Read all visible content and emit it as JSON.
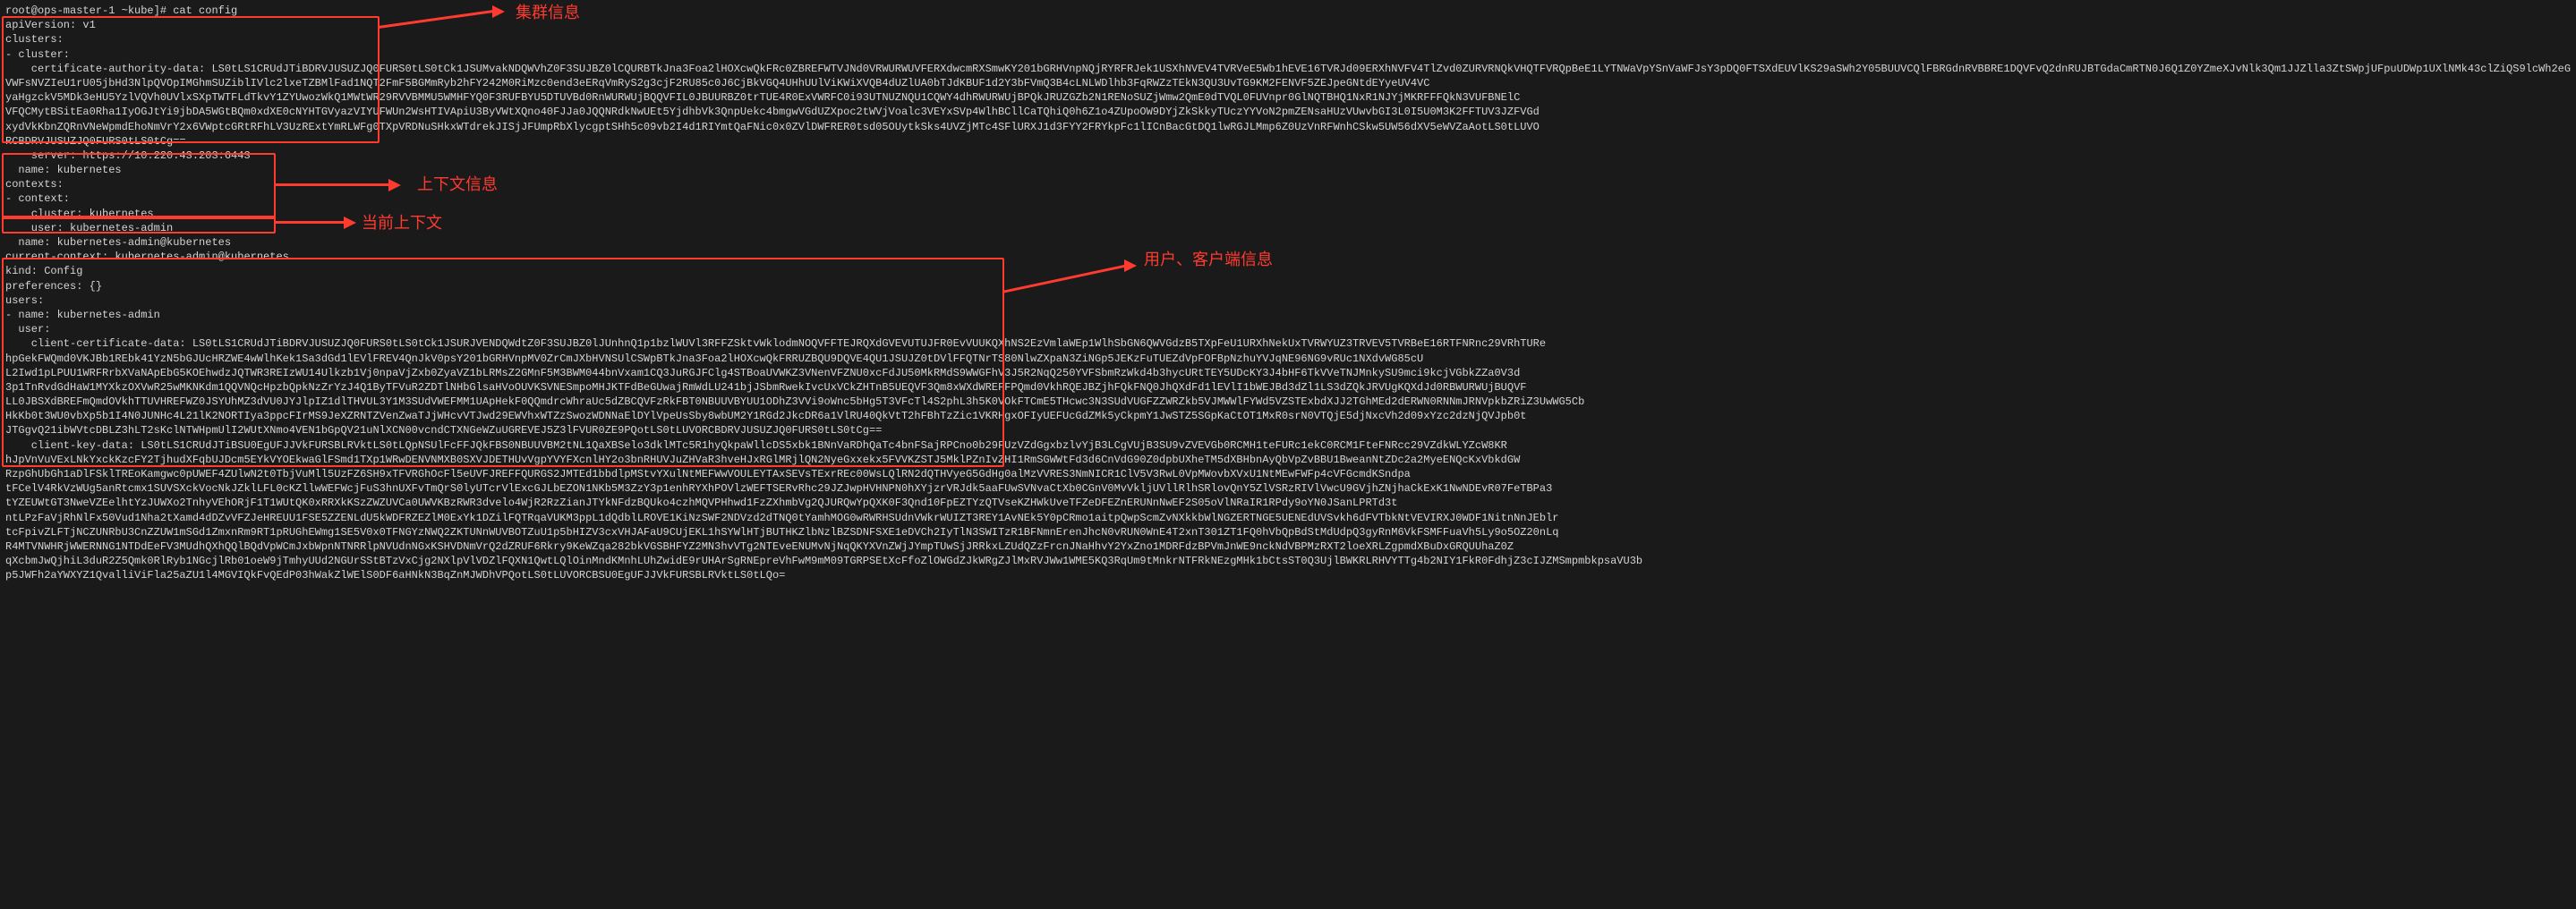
{
  "prompt": "root@ops-master-1 ~kube]# cat config",
  "config_lines": [
    "apiVersion: v1",
    "clusters:",
    "- cluster:",
    "    certificate-authority-data: LS0tLS1CRUdJTiBDRVJUSUZJQ0FURS0tLS0tCk1JSUMvakNDQWVhZ0F3SUJBZ0lCQURBTkJna3Foa2lHOXcwQkFRc0ZBREFWTVJNd0VRWURWUVFERXdwcmRXSmwKY201bGRHVnpNQjRYRFRJek1USXhNVEV4TVRVeE5Wb1hEVE16TVRJd09ERXhNVFV4TlZvd0ZURVRNQkVHQTFVRQpBeE1LYTNWaVpYSnVaWFJsY3pDQ0FTSXdEUVlKS29aSWh2Y05BUUVCQlFBRGdnRVBBRE1DQVFvQ2dnRUJBTGdaCmRTN0J6Q1Z0YZmeXJvNlk3Qm1JJZlla3ZtSWpjUFpuUDWp1UXlNMk43clZiQS9lcWh2eGQ2cmZtczM3B5L1ZyL2F5TEYyMG0waDdsQnRTMlRiUXVHRkRzUTQw",
    "VWFsNVZIeU1rU05jbHd3NlpQVOpIMGhmSUZiblIVlc2lxeTZBMlFad1NQT2FmF5BGMmRyb2hFY242M0RiMzc0end3eERqVmRyS2g3cjF2RU85c0J6CjBkVGQ4UHhUUlViKWiXVQB4dUZlUA0bTJdKBUF1d2Y3bFVmQ3B4cLNLWDlhb3FqRWZzTEkN3QU3UvTG9KM2FENVF5ZEJpeGNtdEYyeUV4VC",
    "yaHgzckV5MDk3eHU5YzlVQVh0UVlxSXpTWTFLdTkvY1ZYUwozWkQ1MWtWR29RVVBMMU5WMHFYQ0F3RUFBYU5DTUVBd0RnWURWUjBQQVFIL0JBUURBZ0trTUE4R0ExVWRFC0i93UTNUZNQU1CQWY4dhRWURWUjBPQkJRUZGZb2N1RENoSUZjWmw2QmE0dTVQL0FUVnpr0GlNQTBHQ1NxR1NJYjMKRFFFQkN3VUFBNElC",
    "VFQCMytBSitEa0Rha1IyOGJtYi9jbDA5WGtBQm0xdXE0cNYHTGVyazVIYUFWUn2WsHTIVApiU3ByVWtXQno40FJJa0JQQNRdkNwUEt5YjdhbVk3QnpUekc4bmgwVGdUZXpoc2tWVjVoalc3VEYxSVp4WlhBCllCaTQhiQ0h6Z1o4ZUpoOW9DYjZkSkkyTUczYYVoN2pmZENsaHUzVUwvbGI3L0I5U0M3K2FFTUV3JZFVGd",
    "xydVkKbnZQRnVNeWpmdEhoNmVrY2x6VWptcGRtRFhLV3UzRExtYmRLWFg0TXpVRDNuSHkxWTdrekJISjJFUmpRbXlycgptSHh5c09vb2I4d1RIYmtQaFNic0x0ZVlDWFRER0tsd05OUytkSks4UVZjMTc4SFlURXJ1d3FYY2FRYkpFc1lICnBacGtDQ1lwRGJLMmp6Z0UzVnRFWnhCSkw5UW56dXV5eWVZaAotLS0tLUVO",
    "RCBDRVJUSUZJQ0FURS0tLS0tCg==",
    "    server: https://10.220.43.203:6443",
    "  name: kubernetes",
    "contexts:",
    "- context:",
    "    cluster: kubernetes",
    "    user: kubernetes-admin",
    "  name: kubernetes-admin@kubernetes",
    "current-context: kubernetes-admin@kubernetes",
    "kind: Config",
    "preferences: {}",
    "users:",
    "- name: kubernetes-admin",
    "  user:",
    "    client-certificate-data: LS0tLS1CRUdJTiBDRVJUSUZJQ0FURS0tLS0tCk1JSURJVENDQWdtZ0F3SUJBZ0lJUnhnQ1p1bzlWUVl3RFFZSktvWklodmNOQVFFTEJRQXdGVEVUTUJFR0EvVUUKQXhNS2EzVmlaWEp1WlhSbGN6QWVGdzB5TXpFeU1URXhNekUxTVRWYUZ3TRVEV5TVRBeE16RTFNRnc29VRhTURe",
    "hpGekFWQmd0VKJBb1REbk41YzN5bGJUcHRZWE4wWlhKek1Sa3dGd1lEVlFREV4QnJkV0psY201bGRHVnpMV0ZrCmJXbHVNSUlCSWpBTkJna3Foa2lHOXcwQkFRRUZBQU9DQVE4QU1JSUJZ0tDVlFFQTNrTS80NlwZXpaN3ZiNGp5JEKzFuTUEZdVpFOFBpNzhuYVJqNE96NG9vRUc1NXdvWG85cU",
    "L2Iwd1pLPUU1WRFRrbXVaNApEbG5KOEhwdzJQTWR3REIzWU14Ulkzb1Vj0npaVjZxb0ZyaVZ1bLRMsZ2GMnF5M3BWM044bnVxam1CQ3JuRGJFClg4STBoaUVWKZ3VNenVFZNU0xcFdJU50MkRMdS9WWGFhV3J5R2NqQ250YVFSbmRzWkd4b3hycURtTEY5UDcKY3J4bHF6TkVVeTNJMnkySU9mci9kcjVGbkZZa0V3d",
    "3p1TnRvdGdHaW1MYXkzOXVwR25wMKNKdm1QQVNQcHpzbQpkNzZrYzJ4Q1ByTFVuR2ZDTlNHbGlsaHVoOUVKSVNESmpoMHJKTFdBeGUwajRmWdLU241bjJSbmRwekIvcUxVCkZHTnB5UEQVF3Qm8xWXdWREFFPQmd0VkhRQEJBZjhFQkFNQ0JhQXdFd1lEVlI1bWEJBd3dZl1LS3dZQkJRVUgKQXdJd0RBWURWUjBUQVF",
    "LL0JBSXdBREFmQmdOVkhTTUVHREFWZ0JSYUhMZ3dVU0JYJlpIZ1dlTHVUL3Y1M3SUdVWEFMM1UApHekF0QQmdrcWhraUc5dZBCQVFzRkFBT0NBUUVBYUU1ODhZ3VVi9oWnc5bHg5T3VFcTl4S2phL3h5K0VOkFTCmE5THcwc3N3SUdVUGFZZWRZkb5VJMWWlFYWd5VZSTExbdXJJ2TGhMEd2dERWN0RNNmJRNVpkbZRiZ3UwWG5Cb",
    "HkKb0t3WU0vbXp5b1I4N0JUNHc4L21lK2NORTIya3ppcFIrMS9JeXZRNTZVenZwaTJjWHcvVTJwd29EWVhxWTZzSwozWDNNaElDYlVpeUsSby8wbUM2Y1RGd2JkcDR6a1VlRU40QkVtT2hFBhTzZic1VKRHgxOFIyUEFUcGdZMk5yCkpmY1JwSTZ5SGpKaCtOT1MxR0srN0VTQjE5djNxcVh2d09xYzc2dzNjQVJpb0t",
    "JTGgvQ21ibWVtcDBLZ3hLT2sKclNTWHpmUlI2WUtXNmo4VEN1bGpQV21uNlXCN00vcndCTXNGeWZuUGREVEJ5Z3lFVUR0ZE9PQotLS0tLUVORCBDRVJUSUZJQ0FURS0tLS0tCg==",
    "    client-key-data: LS0tLS1CRUdJTiBSU0EgUFJJVkFURSBLRVktLS0tLQpNSUlFcFFJQkFBS0NBUUVBM2tNL1QaXBSelo3dklMTc5R1hyQkpaWllcDS5xbk1BNnVaRDhQaTc4bnFSajRPCno0b29FUzVZdGgxbzlvYjB3LCgVUjB3SU9vZVEVGb0RCMH1teFURc1ekC0RCM1FteFNRcc29VZdkWLYZcW8KR",
    "hJpVnVuVExLNkYxckKzcFY2TjhudXFqbUJDcm5EYkVYOEkwaGlFSmd1TXp1WRwDENVNMXB0SXVJDETHUvVgpYVYFXcnlHY2o3bnRHUVJuZHVaR3hveHJxRGlMRjlQN2NyeGxxekx5FVVKZSTJ5MklPZnIvZHI1RmSGWWtFd3d6CnVdG90Z0dpbUXheTM5dXBHbnAyQbVpZvBBU1BweanNtZDc2a2MyeENQcKxVbkdGW",
    "RzpGhUbGh1aDlFSklTREoKamgwc0pUWEF4ZUlwN2t0TbjVuMll5UzFZ6SH9xTFVRGhOcFl5eUVFJREFFQURGS2JMTEd1bbdlpMStvYXulNtMEFWwVOULEYTAxSEVsTExrREc00WsLQlRN2dQTHVyeG5GdHg0alMzVVRES3NmNICR1ClV5V3RwL0VpMWovbXVxU1NtMEwFWFp4cVFGcmdKSndpa",
    "tFCelV4RkVzWUg5anRtcmx1SUVSXckVocNkJZklLFL0cKZllwWEFWcjFuS3hnUXFvTmQrS0lyUTcrVlExcGJLbEZON1NKb5M3ZzY3p1enhRYXhPOVlzWEFTSERvRhc29JZJwpHVHNPN0hXYjzrVRJdk5aaFUwSVNvaCtXb0CGnV0MvVkljUVllRlhSRlovQnY5ZlVSRzRIVlVwcU9GVjhZNjhaCkExK1NwNDEvR07FeTBPa3",
    "tYZEUWtGT3NweVZEelhtYzJUWXo2TnhyVEhORjF1T1WUtQK0xRRXkKSzZWZUVCa0UWVKBzRWR3dvelo4WjR2RzZianJTYkNFdzBQUko4czhMQVPHhwd1FzZXhmbVg2QJURQwYpQXK0F3Qnd10FpEZTYzQTVseKZHWkUveTFZeDFEZnERUNnNwEF2S05oVlNRaIR1RPdy9oYN0JSanLPRTd3t",
    "ntLPzFaVjRhNlFx50Vud1Nha2tXamd4dDZvVFZJeHREUU1FSE5ZZENLdU5kWDFRZEZlM0ExYk1DZilFQTRqaVUKM3ppL1dQdblLROVE1KiNzSWF2NDVzd2dTNQ0tYamhMOG0wRWRHSUdnVWkrWUIZT3REY1AvNEk5Y0pCRmo1aitpQwpScmZvNXkkbWlNGZERTNGE5UENEdUVSvkh6dFVTbkNtVEVIRXJ0WDF1NitnNnJEblr",
    "tcFpivZLFTjNCZUNRbU3CnZZUW1mSGd1ZmxnRm9RT1pRUGhEWmg1SE5V0x0TFNGYzNWQ2ZKTUNnWUVBOTZuU1p5bHIZV3cxVHJAFaU9CUjEKL1hSYWlHTjBUTHKZlbNzlBZSDNFSXE1eDVCh2IyTlN3SWITzR1BFNmnErenJhcN0vRUN0WnE4T2xnT301ZT1FQ0hVbQpBdStMdUdpQ3gyRnM6VkFSMFFuaVh5Ly9o5OZ20nLq",
    "R4MTVNWHRjWWERNNG1NTDdEeFV3MUdhQXhQQlBQdVpWCmJxbWpnNTNRRlpNVUdnNGxKSHVDNmVrQ2dZRUF6Rkry9KeWZqa282bkVGSBHFYZ2MN3hvVTg2NTEveENUMvNjNqQKYXVnZWjJYmpTUwSjJRRkxLZUdQZzFrcnJNaHhvY2YxZno1MDRFdzBPVmJnWE9nckNdVBPMzRXT2loeXRLZgpmdXBuDxGRQUUhaZ0Z",
    "qXcbmJwQjhiL3duR2Z5Qmk0RlRyb1NGcjlRb01oeW9jTmhyUUd2NGUrSStBTzVxCjg2NXlpVlVDZlFQXN1QwtLQlOinMndKMnhLUhZwidE9rUHArSgRNEpreVhFwM9mM09TGRPSEtXcFfoZlOWGdZJkWRgZJlMxRVJWw1WME5KQ3RqUm9tMnkrNTFRkNEzgMHk1bCtsST0Q3UjlBWKRLRHVYTTg4b2NIY1FkR0FdhjZ3cIJZMSmpmbkpsaVU3b",
    "p5JWFh2aYWXYZ1QvalliViFla25aZU1l4MGVIQkFvQEdP03hWakZlWElS0DF6aHNkN3BqZnMJWDhVPQotLS0tLUVORCBSU0EgUFJJVkFURSBLRVktLS0tLQo="
  ],
  "annotations": {
    "cluster": "集群信息",
    "context": "上下文信息",
    "current_context": "当前上下文",
    "users": "用户、客户端信息"
  }
}
